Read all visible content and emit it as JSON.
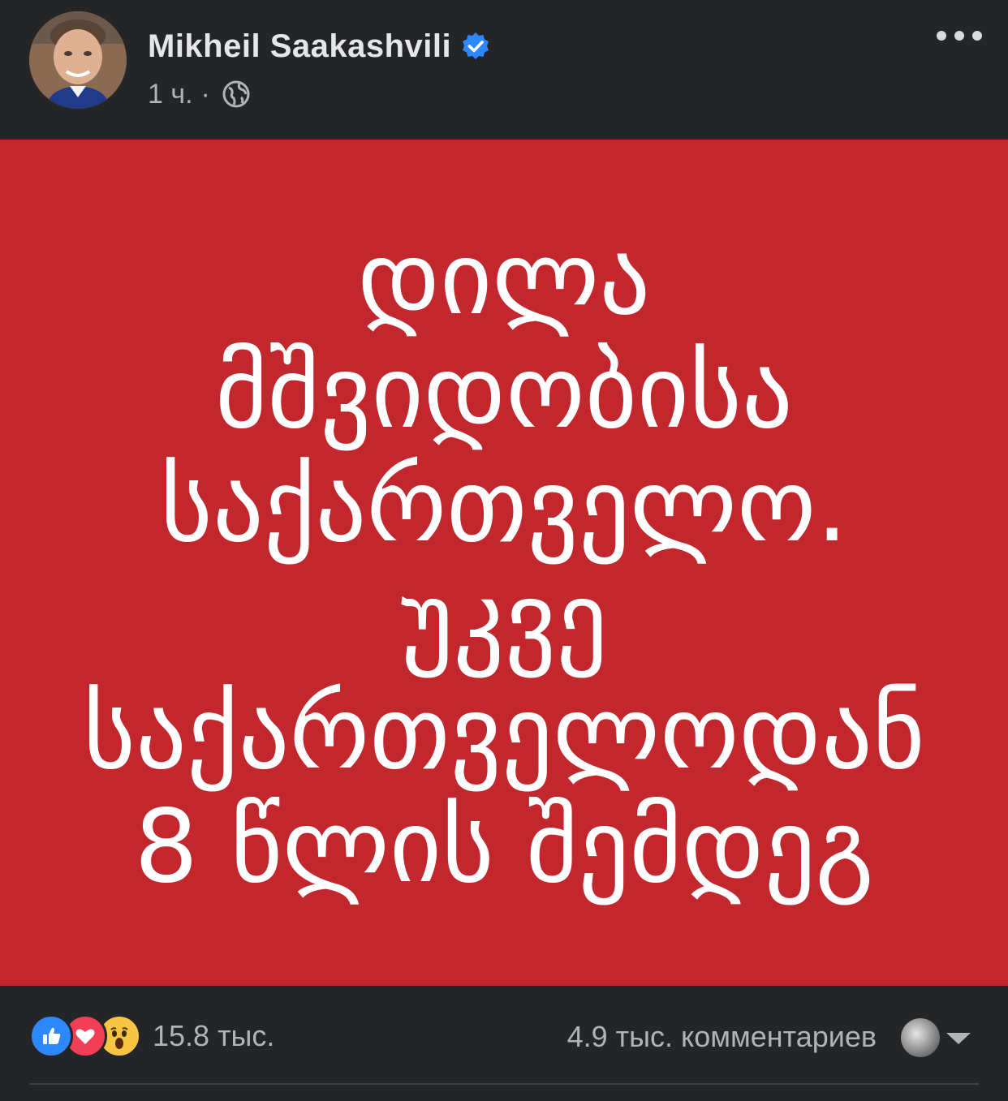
{
  "header": {
    "author": "Mikheil Saakashvili",
    "time": "1 ч.",
    "separator": "·",
    "icons": {
      "verified": "verified-badge-icon",
      "audience": "globe-icon",
      "more": "more-options-icon"
    }
  },
  "image": {
    "background_color": "#c1272d",
    "lines": [
      "დილა",
      "მშვიდობისა",
      "საქართველო.",
      "უკვე",
      "საქართველოდან",
      "8 წლის შემდეგ"
    ]
  },
  "footer": {
    "reactions_count": "15.8 тыс.",
    "comments_label": "4.9 тыс. комментариев",
    "reaction_icons": [
      "like-icon",
      "love-icon",
      "wow-icon"
    ]
  },
  "colors": {
    "background": "#242526",
    "text_primary": "#e4e6eb",
    "text_secondary": "#b0b3b8",
    "verified_blue": "#2d88ff",
    "like_blue": "#2d88ff",
    "love_red": "#f33e58",
    "wow_yellow": "#f7c443"
  }
}
